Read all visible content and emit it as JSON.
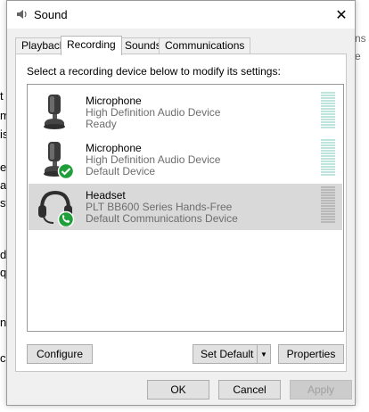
{
  "background": {
    "left_text_fragments": [
      "t",
      "m",
      "is",
      "ea",
      "a",
      "st",
      "d",
      "q",
      "n",
      "c"
    ],
    "right_text_fragments": [
      "ns",
      "e"
    ]
  },
  "window": {
    "title": "Sound",
    "title_icon": "speaker-icon",
    "close_label": "✕"
  },
  "tabs": [
    {
      "label": "Playback",
      "active": false
    },
    {
      "label": "Recording",
      "active": true
    },
    {
      "label": "Sounds",
      "active": false
    },
    {
      "label": "Communications",
      "active": false
    }
  ],
  "instruction": "Select a recording device below to modify its settings:",
  "devices": [
    {
      "name": "Microphone",
      "description": "High Definition Audio Device",
      "status": "Ready",
      "icon": "microphone-icon",
      "badge": "",
      "selected": false
    },
    {
      "name": "Microphone",
      "description": "High Definition Audio Device",
      "status": "Default Device",
      "icon": "microphone-icon",
      "badge": "check-badge-icon",
      "selected": false
    },
    {
      "name": "Headset",
      "description": "PLT BB600 Series Hands-Free",
      "status": "Default Communications Device",
      "icon": "headset-icon",
      "badge": "phone-badge-icon",
      "selected": true
    }
  ],
  "buttons": {
    "configure": "Configure",
    "set_default": "Set Default",
    "set_default_arrow": "▼",
    "properties": "Properties",
    "ok": "OK",
    "cancel": "Cancel",
    "apply": "Apply"
  },
  "colors": {
    "meter": "#a8d8d0",
    "selected_row": "#d9d9d9",
    "badge_green": "#1f9e3a"
  }
}
